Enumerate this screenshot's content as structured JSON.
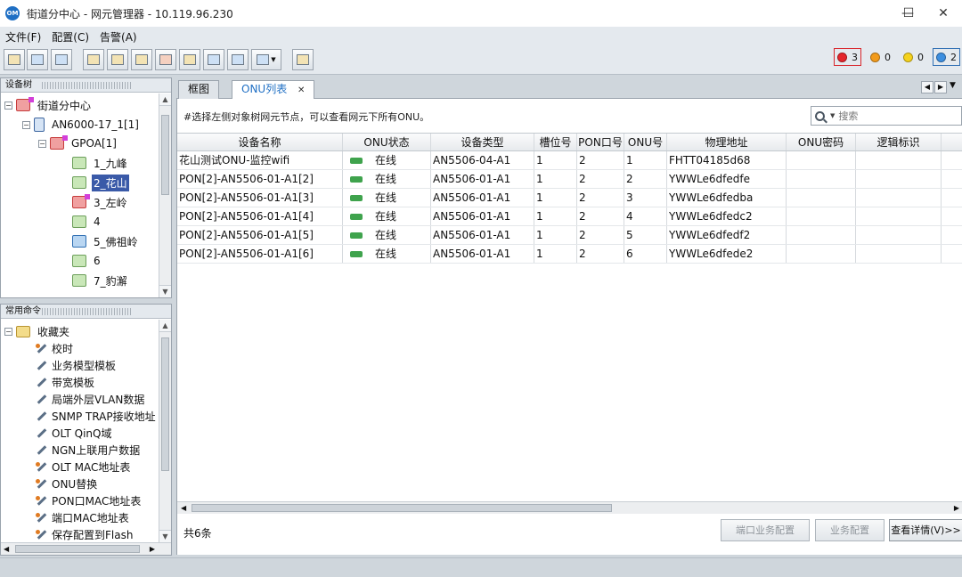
{
  "window": {
    "title": "街道分中心 - 网元管理器 - 10.119.96.230",
    "minimize_icon": "minimize-icon",
    "maximize_icon": "maximize-icon",
    "close_icon": "close-icon"
  },
  "menu": [
    {
      "label": "文件(F)"
    },
    {
      "label": "配置(C)"
    },
    {
      "label": "告警(A)"
    }
  ],
  "alarms": [
    {
      "count": "3",
      "color": "#e5262c",
      "name": "critical"
    },
    {
      "count": "0",
      "color": "#f29b1c",
      "name": "major"
    },
    {
      "count": "0",
      "color": "#f5d21c",
      "name": "minor"
    },
    {
      "count": "2",
      "color": "#3d8fe0",
      "name": "warning"
    }
  ],
  "device_tree": {
    "title": "设备树",
    "nodes": [
      {
        "label": "街道分中心"
      },
      {
        "label": "AN6000-17_1[1]"
      },
      {
        "label": "GPOA[1]"
      },
      {
        "label": "1_九峰"
      },
      {
        "label": "2_花山"
      },
      {
        "label": "3_左岭"
      },
      {
        "label": "4"
      },
      {
        "label": "5_佛祖岭"
      },
      {
        "label": "6"
      },
      {
        "label": "7_豹澥"
      }
    ]
  },
  "commands": {
    "title": "常用命令",
    "folder": "收藏夹",
    "items": [
      {
        "label": "校时"
      },
      {
        "label": "业务模型模板"
      },
      {
        "label": "带宽模板"
      },
      {
        "label": "局端外层VLAN数据"
      },
      {
        "label": "SNMP TRAP接收地址"
      },
      {
        "label": "OLT QinQ域"
      },
      {
        "label": "NGN上联用户数据"
      },
      {
        "label": "OLT MAC地址表"
      },
      {
        "label": "ONU替换"
      },
      {
        "label": "PON口MAC地址表"
      },
      {
        "label": "端口MAC地址表"
      },
      {
        "label": "保存配置到Flash"
      }
    ]
  },
  "tabs": [
    {
      "label": "框图"
    },
    {
      "label": "ONU列表"
    }
  ],
  "main": {
    "hint": "#选择左侧对象树网元节点，可以查看网元下所有ONU。",
    "search_placeholder": "搜索",
    "columns": [
      "设备名称",
      "ONU状态",
      "设备类型",
      "槽位号",
      "PON口号",
      "ONU号",
      "物理地址",
      "ONU密码",
      "逻辑标识"
    ],
    "rows": [
      {
        "name": "花山测试ONU-监控wifi",
        "status": "在线",
        "type": "AN5506-04-A1",
        "slot": "1",
        "pon": "2",
        "onu": "1",
        "mac": "FHTT04185d68",
        "pwd": "",
        "logic": ""
      },
      {
        "name": "PON[2]-AN5506-01-A1[2]",
        "status": "在线",
        "type": "AN5506-01-A1",
        "slot": "1",
        "pon": "2",
        "onu": "2",
        "mac": "YWWLe6dfedfe",
        "pwd": "",
        "logic": ""
      },
      {
        "name": "PON[2]-AN5506-01-A1[3]",
        "status": "在线",
        "type": "AN5506-01-A1",
        "slot": "1",
        "pon": "2",
        "onu": "3",
        "mac": "YWWLe6dfedba",
        "pwd": "",
        "logic": ""
      },
      {
        "name": "PON[2]-AN5506-01-A1[4]",
        "status": "在线",
        "type": "AN5506-01-A1",
        "slot": "1",
        "pon": "2",
        "onu": "4",
        "mac": "YWWLe6dfedc2",
        "pwd": "",
        "logic": ""
      },
      {
        "name": "PON[2]-AN5506-01-A1[5]",
        "status": "在线",
        "type": "AN5506-01-A1",
        "slot": "1",
        "pon": "2",
        "onu": "5",
        "mac": "YWWLe6dfedf2",
        "pwd": "",
        "logic": ""
      },
      {
        "name": "PON[2]-AN5506-01-A1[6]",
        "status": "在线",
        "type": "AN5506-01-A1",
        "slot": "1",
        "pon": "2",
        "onu": "6",
        "mac": "YWWLe6dfede2",
        "pwd": "",
        "logic": ""
      }
    ],
    "count_text": "共6条",
    "buttons": {
      "port_service": "端口业务配置",
      "service": "业务配置",
      "details": "查看详情(V)>>"
    }
  }
}
